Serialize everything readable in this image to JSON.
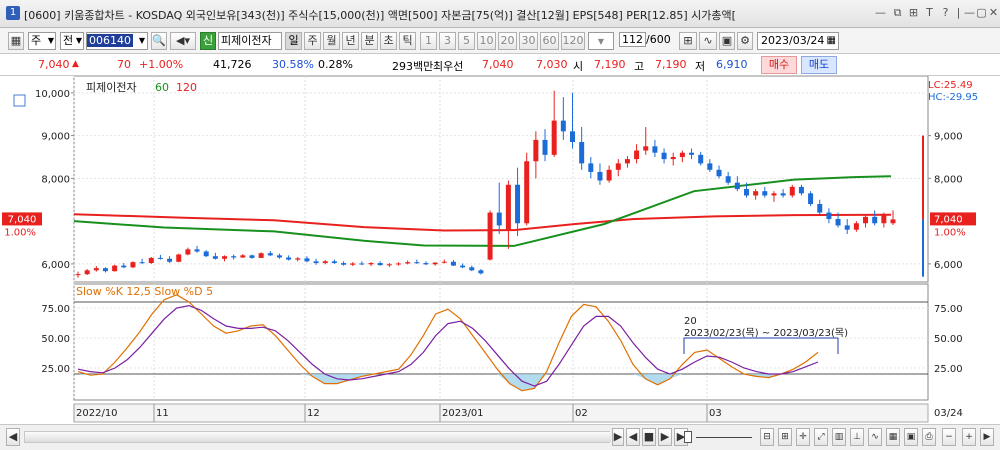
{
  "window": {
    "app_number": "1",
    "title": "[0600] 키움종합차트 - KOSDAQ 외국인보유[343(천)] 주식수[15,000(천)] 액면[500] 자본금[75(억)] 결산[12월] EPS[548] PER[12.85] 시가총액[",
    "controls": [
      "—",
      "⧉",
      "⊞",
      "T",
      "?",
      "|",
      "—",
      "▢",
      "✕"
    ]
  },
  "toolbar": {
    "period_type": "주",
    "market": "전",
    "code": "006140",
    "stock_name": "피제이전자",
    "new_badge": "신",
    "periods": [
      "일",
      "주",
      "월",
      "년",
      "분",
      "초",
      "틱"
    ],
    "active_period": "일",
    "intervals": [
      "1",
      "3",
      "5",
      "10",
      "20",
      "30",
      "60",
      "120"
    ],
    "count": "112",
    "count_max": "/600",
    "date": "2023/03/24"
  },
  "quote": {
    "price": "7,040",
    "change": "70",
    "change_pct": "+1.00%",
    "volume": "41,726",
    "vol_ratio": "30.58%",
    "turnover": "0.28%",
    "amount": "293백만",
    "ask_label": "최우선",
    "ask": "7,040",
    "bid": "7,030",
    "open_label": "시",
    "open": "7,190",
    "high_label": "고",
    "high": "7,190",
    "low_label": "저",
    "low": "6,910",
    "buy_label": "매수",
    "sell_label": "매도"
  },
  "colors": {
    "up": "#e8211f",
    "down": "#1c6cd8",
    "ma60": "#17901d",
    "ma120": "#e8211f",
    "k": "#e07000",
    "d": "#7a1fa2"
  },
  "chart_data": [
    {
      "type": "candlestick",
      "title": "피제이전자",
      "legend": [
        "60",
        "120"
      ],
      "ylim": [
        5600,
        10300
      ],
      "y_ticks": [
        "10,000",
        "9,000",
        "8,000",
        "6,000"
      ],
      "y_ticks_right": [
        "9,000",
        "8,000",
        "6,000"
      ],
      "last_price_label": "7,040",
      "last_pct_label": "1.00%",
      "lc_label": "LC:25.49",
      "hc_label": "HC:-29.95",
      "x_labels": [
        "2022/10",
        "11",
        "12",
        "2023/01",
        "02",
        "03"
      ],
      "x_last_label": "03/24",
      "candles": [
        [
          5750,
          5820,
          5680,
          5760
        ],
        [
          5760,
          5880,
          5740,
          5850
        ],
        [
          5850,
          5950,
          5820,
          5900
        ],
        [
          5900,
          5920,
          5800,
          5830
        ],
        [
          5830,
          5980,
          5820,
          5960
        ],
        [
          5960,
          6020,
          5900,
          5920
        ],
        [
          5920,
          6060,
          5900,
          6040
        ],
        [
          6040,
          6120,
          6000,
          6020
        ],
        [
          6020,
          6160,
          6000,
          6140
        ],
        [
          6140,
          6210,
          6100,
          6120
        ],
        [
          6120,
          6180,
          6020,
          6050
        ],
        [
          6050,
          6240,
          6040,
          6220
        ],
        [
          6220,
          6380,
          6200,
          6340
        ],
        [
          6340,
          6420,
          6260,
          6290
        ],
        [
          6290,
          6320,
          6160,
          6180
        ],
        [
          6180,
          6260,
          6100,
          6120
        ],
        [
          6120,
          6200,
          6060,
          6180
        ],
        [
          6180,
          6220,
          6100,
          6150
        ],
        [
          6150,
          6230,
          6140,
          6200
        ],
        [
          6200,
          6220,
          6120,
          6140
        ],
        [
          6140,
          6270,
          6140,
          6250
        ],
        [
          6250,
          6300,
          6180,
          6200
        ],
        [
          6200,
          6240,
          6120,
          6150
        ],
        [
          6150,
          6200,
          6080,
          6100
        ],
        [
          6100,
          6160,
          6060,
          6130
        ],
        [
          6130,
          6180,
          6040,
          6060
        ],
        [
          6060,
          6120,
          5980,
          6020
        ],
        [
          6020,
          6090,
          5990,
          6060
        ],
        [
          6060,
          6100,
          6000,
          6020
        ],
        [
          6020,
          6060,
          5960,
          5980
        ],
        [
          5980,
          6040,
          5950,
          6010
        ],
        [
          6010,
          6060,
          5970,
          5990
        ],
        [
          5990,
          6040,
          5950,
          6020
        ],
        [
          6020,
          6060,
          5960,
          5970
        ],
        [
          5970,
          6020,
          5930,
          5990
        ],
        [
          5990,
          6040,
          5960,
          6010
        ],
        [
          6010,
          6080,
          5990,
          6040
        ],
        [
          6040,
          6100,
          6000,
          6020
        ],
        [
          6020,
          6060,
          5970,
          5990
        ],
        [
          5990,
          6040,
          5960,
          6030
        ],
        [
          6030,
          6100,
          6010,
          6050
        ],
        [
          6050,
          6090,
          5950,
          5960
        ],
        [
          5960,
          6010,
          5900,
          5920
        ],
        [
          5920,
          5960,
          5830,
          5850
        ],
        [
          5850,
          5880,
          5750,
          5780
        ],
        [
          6100,
          7250,
          6080,
          7200
        ],
        [
          7200,
          7900,
          6700,
          6900
        ],
        [
          6800,
          7950,
          6350,
          7850
        ],
        [
          7850,
          8250,
          6650,
          6950
        ],
        [
          6950,
          8600,
          6900,
          8400
        ],
        [
          8400,
          9100,
          8000,
          8900
        ],
        [
          8900,
          9150,
          8400,
          8550
        ],
        [
          8550,
          10050,
          8500,
          9350
        ],
        [
          9350,
          9900,
          8900,
          9100
        ],
        [
          9100,
          10000,
          8700,
          8850
        ],
        [
          8850,
          9200,
          8200,
          8350
        ],
        [
          8350,
          8500,
          8000,
          8150
        ],
        [
          8150,
          8350,
          7850,
          7950
        ],
        [
          7950,
          8300,
          7900,
          8200
        ],
        [
          8200,
          8450,
          8050,
          8350
        ],
        [
          8350,
          8520,
          8250,
          8450
        ],
        [
          8450,
          8800,
          8350,
          8650
        ],
        [
          8650,
          9200,
          8550,
          8750
        ],
        [
          8750,
          8900,
          8500,
          8600
        ],
        [
          8600,
          8700,
          8350,
          8450
        ],
        [
          8450,
          8600,
          8300,
          8500
        ],
        [
          8500,
          8650,
          8380,
          8600
        ],
        [
          8600,
          8700,
          8450,
          8550
        ],
        [
          8550,
          8620,
          8300,
          8350
        ],
        [
          8350,
          8450,
          8150,
          8200
        ],
        [
          8200,
          8300,
          8000,
          8050
        ],
        [
          8050,
          8150,
          7850,
          7900
        ],
        [
          7900,
          8050,
          7700,
          7750
        ],
        [
          7750,
          7900,
          7550,
          7600
        ],
        [
          7600,
          7750,
          7500,
          7700
        ],
        [
          7700,
          7800,
          7550,
          7600
        ],
        [
          7600,
          7700,
          7450,
          7650
        ],
        [
          7650,
          7750,
          7550,
          7600
        ],
        [
          7600,
          7850,
          7550,
          7800
        ],
        [
          7800,
          7850,
          7600,
          7650
        ],
        [
          7650,
          7700,
          7350,
          7400
        ],
        [
          7400,
          7500,
          7150,
          7200
        ],
        [
          7200,
          7300,
          6950,
          7050
        ],
        [
          7050,
          7200,
          6850,
          6900
        ],
        [
          6900,
          7050,
          6700,
          6800
        ],
        [
          6800,
          7000,
          6750,
          6950
        ],
        [
          6950,
          7150,
          6850,
          7100
        ],
        [
          7100,
          7250,
          6900,
          6950
        ],
        [
          6950,
          7200,
          6850,
          7150
        ],
        [
          6950,
          7250,
          6910,
          7040
        ]
      ],
      "ma60": [
        [
          0,
          7000
        ],
        [
          90,
          6850
        ],
        [
          200,
          6760
        ],
        [
          290,
          6540
        ],
        [
          350,
          6430
        ],
        [
          440,
          6420
        ],
        [
          530,
          6930
        ],
        [
          620,
          7700
        ],
        [
          720,
          7970
        ],
        [
          780,
          8030
        ],
        [
          817,
          8050
        ]
      ],
      "ma120": [
        [
          0,
          7160
        ],
        [
          110,
          7080
        ],
        [
          200,
          7020
        ],
        [
          290,
          6860
        ],
        [
          370,
          6780
        ],
        [
          440,
          6790
        ],
        [
          500,
          6930
        ],
        [
          560,
          7050
        ],
        [
          640,
          7110
        ],
        [
          720,
          7140
        ],
        [
          817,
          7150
        ]
      ]
    },
    {
      "type": "line",
      "title": "Slow %K 12,5  Slow %D 5",
      "ylim": [
        0,
        95
      ],
      "y_ticks": [
        "75.00",
        "50.00",
        "25.00"
      ],
      "y_ticks_right": [
        "75.00",
        "50.00",
        "25.00"
      ],
      "annotation_count": "20",
      "annotation_range": "2023/02/23(목) ~ 2023/03/23(목)",
      "k": [
        22,
        19,
        20,
        30,
        42,
        55,
        70,
        82,
        86,
        80,
        70,
        60,
        54,
        56,
        60,
        61,
        52,
        40,
        28,
        18,
        12,
        12,
        15,
        18,
        20,
        22,
        24,
        36,
        52,
        70,
        74,
        66,
        52,
        38,
        24,
        12,
        6,
        8,
        22,
        46,
        68,
        78,
        76,
        64,
        48,
        28,
        16,
        11,
        16,
        28,
        38,
        40,
        33,
        26,
        20,
        18,
        17,
        20,
        24,
        30,
        38
      ],
      "d": [
        24,
        22,
        21,
        25,
        32,
        42,
        54,
        66,
        75,
        77,
        73,
        66,
        60,
        58,
        58,
        59,
        56,
        48,
        38,
        28,
        20,
        16,
        15,
        16,
        18,
        20,
        22,
        28,
        38,
        52,
        62,
        64,
        58,
        48,
        36,
        24,
        14,
        10,
        14,
        28,
        44,
        60,
        68,
        68,
        60,
        46,
        34,
        24,
        20,
        24,
        30,
        35,
        34,
        30,
        25,
        22,
        20,
        20,
        22,
        26,
        30
      ]
    }
  ],
  "bottom": {
    "controls": [
      "◀",
      "▶",
      "◀",
      "■",
      "▶",
      "▶"
    ]
  }
}
